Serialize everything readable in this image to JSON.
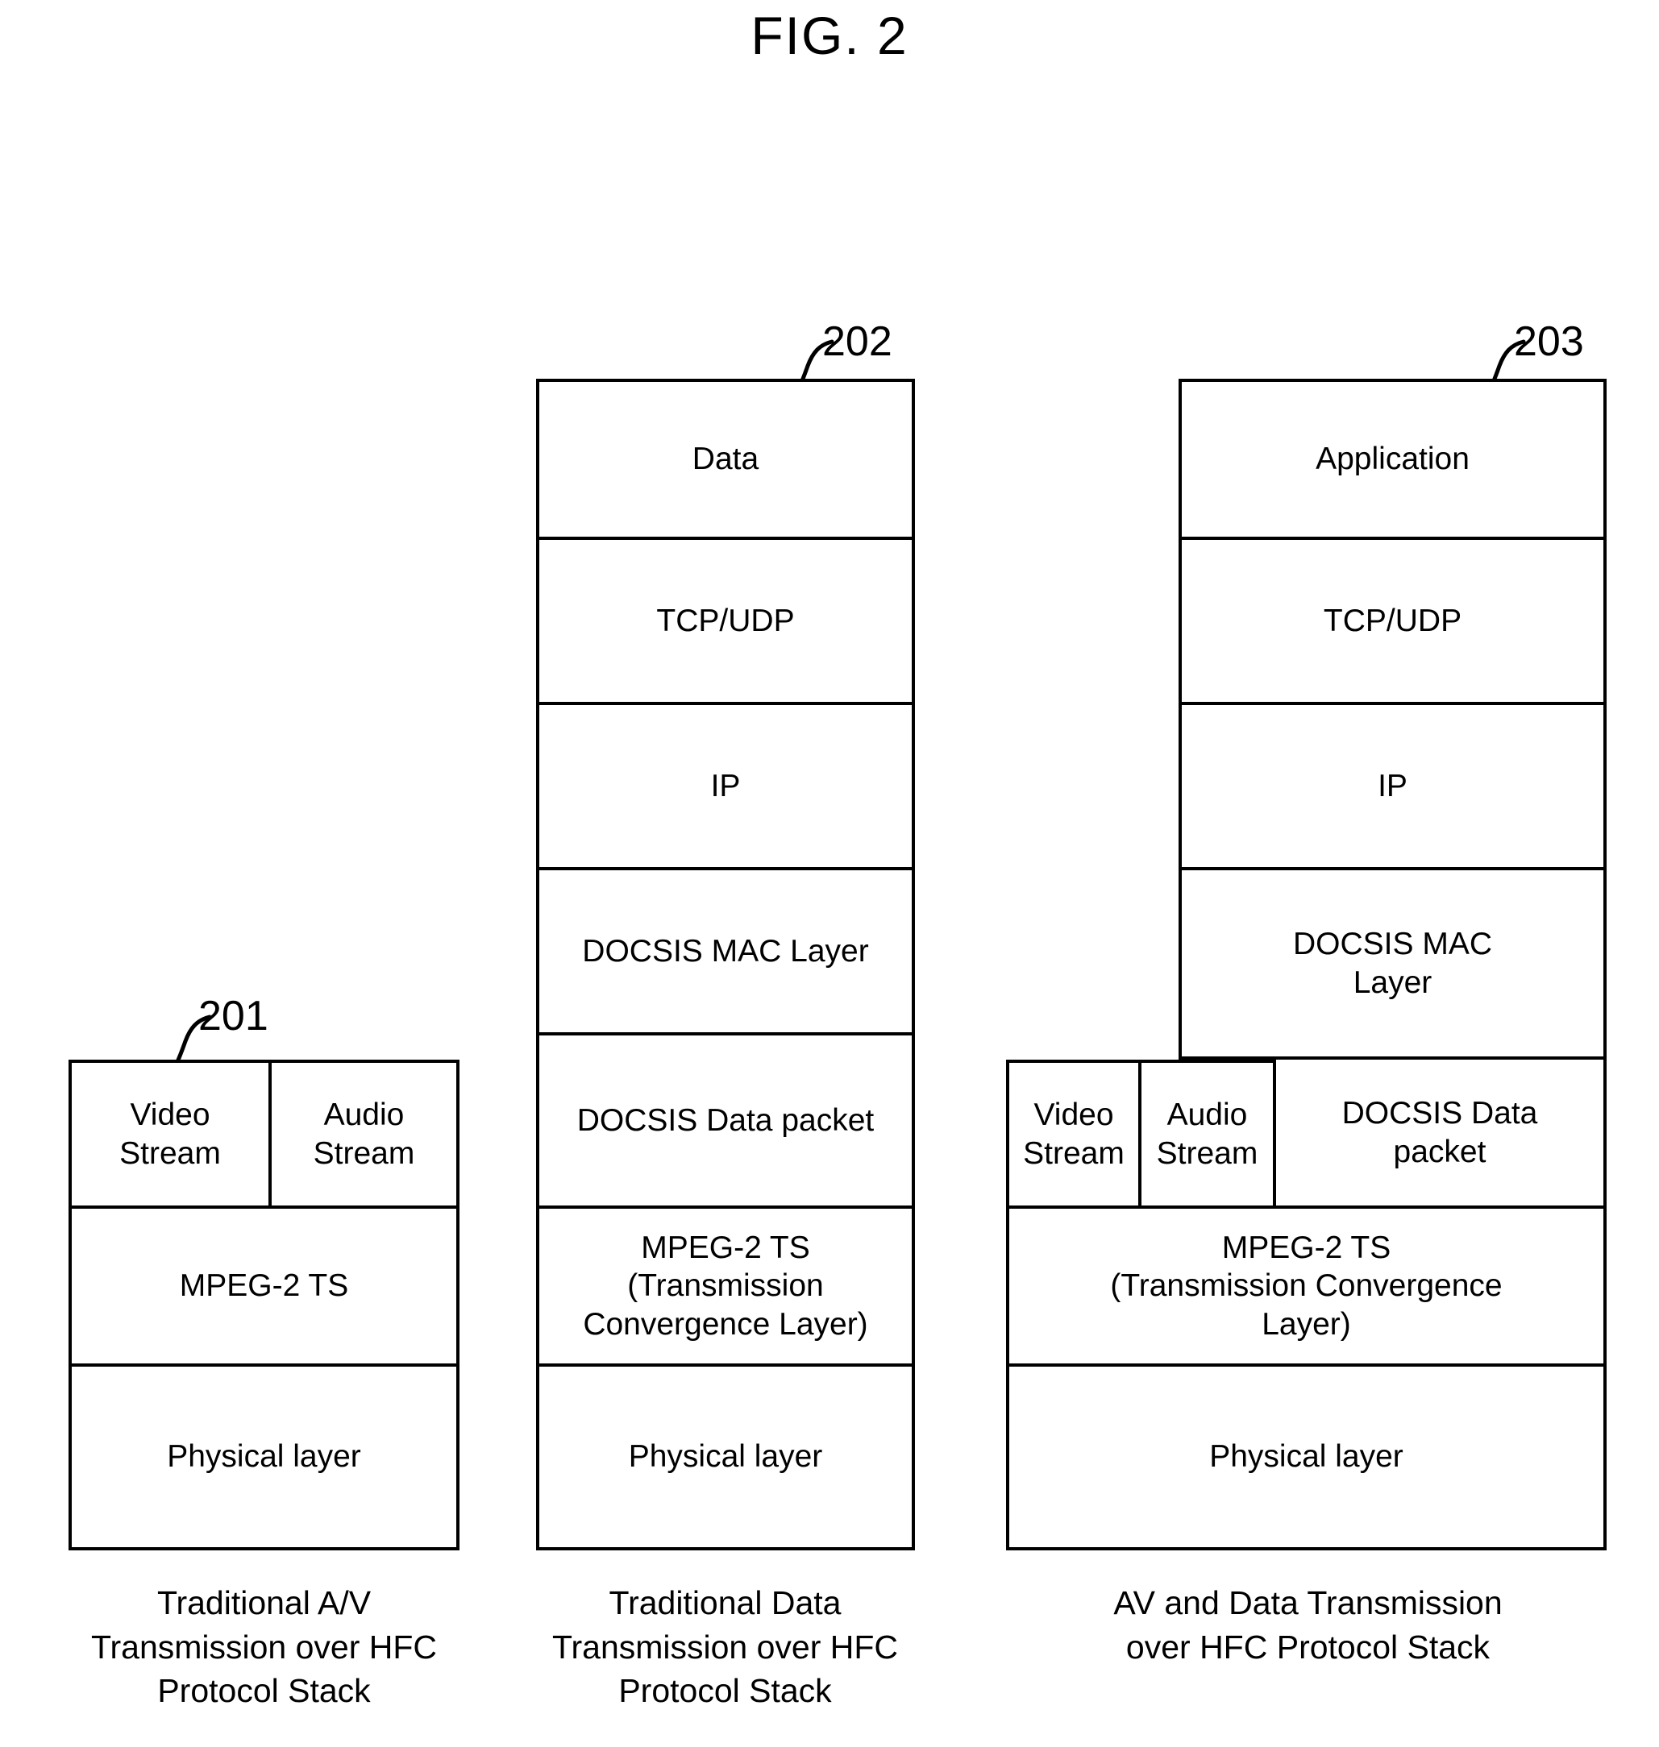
{
  "figure": {
    "title": "FIG. 2"
  },
  "stacks": [
    {
      "ref": "201",
      "caption": "Traditional A/V\nTransmission over HFC\nProtocol Stack",
      "layers": {
        "video_stream": "Video\nStream",
        "audio_stream": "Audio\nStream",
        "mpeg2_ts": "MPEG-2 TS",
        "physical_layer": "Physical layer"
      }
    },
    {
      "ref": "202",
      "caption": "Traditional Data\nTransmission over HFC\nProtocol Stack",
      "layers": {
        "data": "Data",
        "tcp_udp": "TCP/UDP",
        "ip": "IP",
        "docsis_mac": "DOCSIS MAC Layer",
        "docsis_data_packet": "DOCSIS Data packet",
        "mpeg2_ts": "MPEG-2 TS\n(Transmission\nConvergence Layer)",
        "physical_layer": "Physical layer"
      }
    },
    {
      "ref": "203",
      "caption": "AV and Data Transmission\nover HFC Protocol Stack",
      "layers": {
        "application": "Application",
        "tcp_udp": "TCP/UDP",
        "ip": "IP",
        "docsis_mac": "DOCSIS MAC\nLayer",
        "video_stream": "Video\nStream",
        "audio_stream": "Audio\nStream",
        "docsis_data_packet": "DOCSIS Data\npacket",
        "mpeg2_ts": "MPEG-2 TS\n(Transmission Convergence\nLayer)",
        "physical_layer": "Physical layer"
      }
    }
  ],
  "colors": {
    "ink": "#000000",
    "paper": "#ffffff"
  }
}
